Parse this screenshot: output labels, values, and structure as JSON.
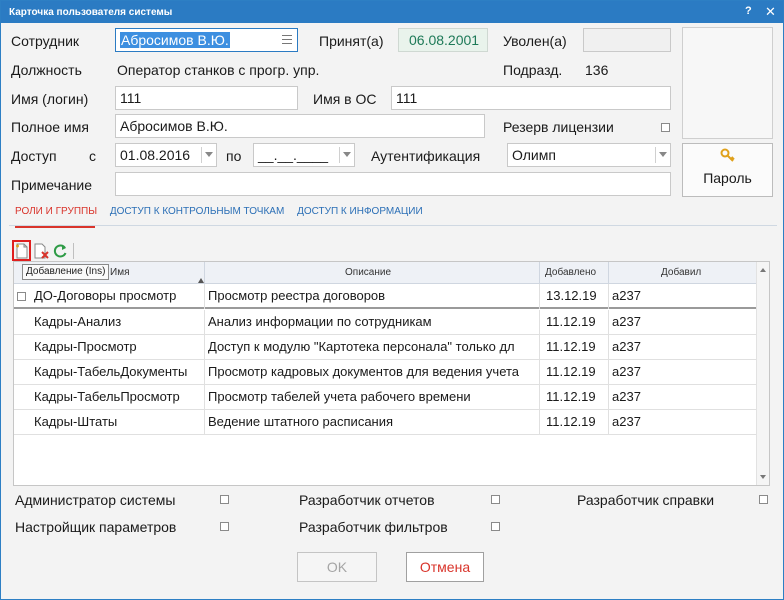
{
  "window": {
    "title": "Карточка пользователя системы",
    "help": "?",
    "close": "✕"
  },
  "form": {
    "employee_label": "Сотрудник",
    "employee_value": "Абросимов В.Ю.",
    "hired_label": "Принят(а)",
    "hired_value": "06.08.2001",
    "fired_label": "Уволен(а)",
    "fired_value": "",
    "position_label": "Должность",
    "position_value": "Оператор станков с прогр. упр.",
    "dept_label": "Подразд.",
    "dept_value": "136",
    "login_label": "Имя (логин)",
    "login_value": "111",
    "os_label": "Имя в ОС",
    "os_value": "111",
    "fullname_label": "Полное имя",
    "fullname_value": "Абросимов В.Ю.",
    "license_label": "Резерв лицензии",
    "access_label": "Доступ",
    "access_from_label": "с",
    "access_from_value": "01.08.2016",
    "access_to_label": "по",
    "access_to_value": "__.__.____",
    "auth_label": "Аутентификация",
    "auth_value": "Олимп",
    "note_label": "Примечание",
    "note_value": "",
    "password_button": "Пароль"
  },
  "tabs": [
    {
      "label": "РОЛИ И ГРУППЫ",
      "active": true
    },
    {
      "label": "ДОСТУП К КОНТРОЛЬНЫМ ТОЧКАМ",
      "active": false
    },
    {
      "label": "ДОСТУП К ИНФОРМАЦИИ",
      "active": false
    }
  ],
  "toolbar": {
    "add_tooltip": "Добавление (Ins)",
    "icons": [
      "add-document-icon",
      "delete-document-icon",
      "refresh-icon"
    ]
  },
  "grid": {
    "columns": [
      "Имя",
      "Описание",
      "Добавлено",
      "Добавил"
    ],
    "rows": [
      {
        "name": "ДО-Договоры просмотр",
        "desc": "Просмотр реестра договоров",
        "added": "13.12.19",
        "by": "a237"
      },
      {
        "name": "Кадры-Анализ",
        "desc": "Анализ информации по сотрудникам",
        "added": "11.12.19",
        "by": "a237"
      },
      {
        "name": "Кадры-Просмотр",
        "desc": "Доступ к модулю \"Картотека персонала\" только дл",
        "added": "11.12.19",
        "by": "a237"
      },
      {
        "name": "Кадры-ТабельДокументы",
        "desc": "Просмотр кадровых документов для ведения учета",
        "added": "11.12.19",
        "by": "a237"
      },
      {
        "name": "Кадры-ТабельПросмотр",
        "desc": "Просмотр табелей учета рабочего времени",
        "added": "11.12.19",
        "by": "a237"
      },
      {
        "name": "Кадры-Штаты",
        "desc": "Ведение штатного расписания",
        "added": "11.12.19",
        "by": "a237"
      }
    ]
  },
  "options": {
    "admin": "Администратор системы",
    "reports_dev": "Разработчик отчетов",
    "help_dev": "Разработчик справки",
    "params": "Настройщик параметров",
    "filters_dev": "Разработчик фильтров"
  },
  "buttons": {
    "ok": "OK",
    "cancel": "Отмена"
  },
  "colors": {
    "titlebar": "#2b7bc3",
    "accent_red": "#d9342b",
    "link_blue": "#2b6fb6",
    "hired_green": "#1e7a58"
  }
}
